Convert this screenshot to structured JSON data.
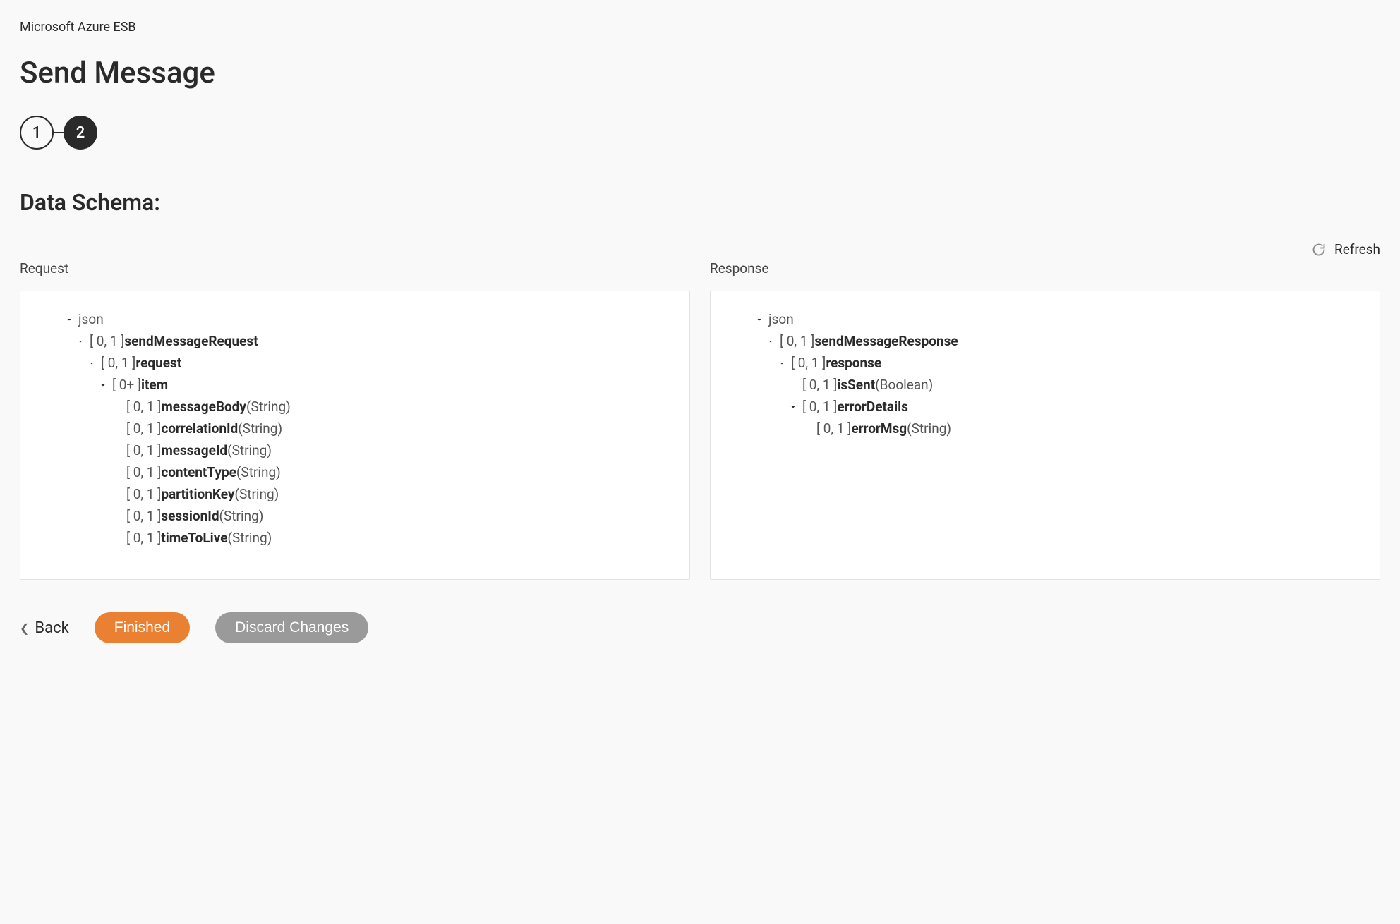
{
  "breadcrumb": "Microsoft Azure ESB",
  "pageTitle": "Send Message",
  "stepper": {
    "step1": "1",
    "step2": "2"
  },
  "sectionHeading": "Data Schema:",
  "refresh": {
    "label": "Refresh"
  },
  "panels": {
    "request": {
      "label": "Request",
      "tree": [
        {
          "indent": 0,
          "caret": true,
          "card": "",
          "name": "json",
          "type": ""
        },
        {
          "indent": 1,
          "caret": true,
          "card": "[ 0, 1 ]",
          "name": "sendMessageRequest",
          "type": ""
        },
        {
          "indent": 2,
          "caret": true,
          "card": "[ 0, 1 ]",
          "name": "request",
          "type": ""
        },
        {
          "indent": 3,
          "caret": true,
          "card": "[ 0+ ]",
          "name": "item",
          "type": ""
        },
        {
          "indent": 4,
          "caret": false,
          "card": "[ 0, 1 ]",
          "name": "messageBody",
          "type": "(String)"
        },
        {
          "indent": 4,
          "caret": false,
          "card": "[ 0, 1 ]",
          "name": "correlationId",
          "type": "(String)"
        },
        {
          "indent": 4,
          "caret": false,
          "card": "[ 0, 1 ]",
          "name": "messageId",
          "type": "(String)"
        },
        {
          "indent": 4,
          "caret": false,
          "card": "[ 0, 1 ]",
          "name": "contentType",
          "type": "(String)"
        },
        {
          "indent": 4,
          "caret": false,
          "card": "[ 0, 1 ]",
          "name": "partitionKey",
          "type": "(String)"
        },
        {
          "indent": 4,
          "caret": false,
          "card": "[ 0, 1 ]",
          "name": "sessionId",
          "type": "(String)"
        },
        {
          "indent": 4,
          "caret": false,
          "card": "[ 0, 1 ]",
          "name": "timeToLive",
          "type": "(String)"
        }
      ]
    },
    "response": {
      "label": "Response",
      "tree": [
        {
          "indent": 0,
          "caret": true,
          "card": "",
          "name": "json",
          "type": ""
        },
        {
          "indent": 1,
          "caret": true,
          "card": "[ 0, 1 ]",
          "name": "sendMessageResponse",
          "type": ""
        },
        {
          "indent": 2,
          "caret": true,
          "card": "[ 0, 1 ]",
          "name": "response",
          "type": ""
        },
        {
          "indent": 3,
          "caret": false,
          "card": "[ 0, 1 ]",
          "name": "isSent",
          "type": "(Boolean)"
        },
        {
          "indent": 3,
          "caret": true,
          "card": "[ 0, 1 ]",
          "name": "errorDetails",
          "type": ""
        },
        {
          "indent": 4,
          "caret": false,
          "card": "[ 0, 1 ]",
          "name": "errorMsg",
          "type": "(String)"
        }
      ]
    }
  },
  "footer": {
    "back": "Back",
    "finished": "Finished",
    "discard": "Discard Changes"
  }
}
